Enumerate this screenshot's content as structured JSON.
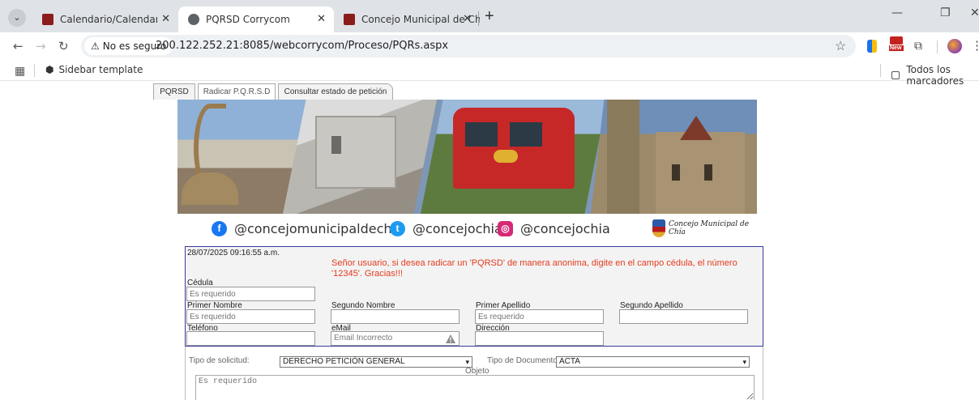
{
  "browser": {
    "tabs": [
      {
        "title": "Calendario/Calendario de Sesio",
        "favicon_color": "#8a1c1c",
        "active": false
      },
      {
        "title": "PQRSD Corrycom",
        "favicon_color": "#5f6368",
        "active": true
      },
      {
        "title": "Concejo Municipal de Chía",
        "favicon_color": "#8a1c1c",
        "active": false
      }
    ],
    "close_glyph": "✕",
    "new_tab_glyph": "+",
    "security_label": "No es seguro",
    "url": "200.122.252.21:8085/webcorrycom/Proceso/PQRs.aspx",
    "extension_badge": "New",
    "bookmarks": [
      {
        "label": "Sidebar template"
      }
    ],
    "bookmarks_folder": "Todos los marcadores"
  },
  "page": {
    "tabs": [
      "PQRSD",
      "Radicar P.Q.R.S.D",
      "Consultar estado de petición"
    ],
    "social": {
      "facebook": "@concejomunicipaldechia",
      "twitter": "@concejochia",
      "instagram": "@concejochia",
      "crest_text": "Concejo Municipal de Chía"
    },
    "form": {
      "datetime": "28/07/2025 09:16:55 a.m.",
      "notice": "Señor usuario, si desea radicar un 'PQRSD' de manera anonima, digite en el campo cédula, el número '12345'. Gracias!!!",
      "cedula_label": "Cédula",
      "cedula_placeholder": "Es requerido",
      "primer_nombre_label": "Primer Nombre",
      "primer_nombre_placeholder": "Es requerido",
      "segundo_nombre_label": "Segundo Nombre",
      "primer_apellido_label": "Primer Apellido",
      "primer_apellido_placeholder": "Es requerido",
      "segundo_apellido_label": "Segundo Apellido",
      "telefono_label": "Teléfono",
      "email_label": "eMail",
      "email_value": "Email Incorrecto",
      "direccion_label": "Dirección",
      "tipo_solicitud_label": "Tipo de solicitud:",
      "tipo_solicitud_value": "DERECHO PETICIÓN GENERAL",
      "tipo_documento_label": "Tipo de Documento:",
      "tipo_documento_value": "ACTA",
      "objeto_label": "Objeto",
      "objeto_placeholder": "Es requerido"
    }
  },
  "colors": {
    "notice": "#e53b1e",
    "form_border": "#3a3a9e",
    "facebook": "#1877f2",
    "twitter": "#1d9bf0",
    "instagram": "#d62976"
  }
}
